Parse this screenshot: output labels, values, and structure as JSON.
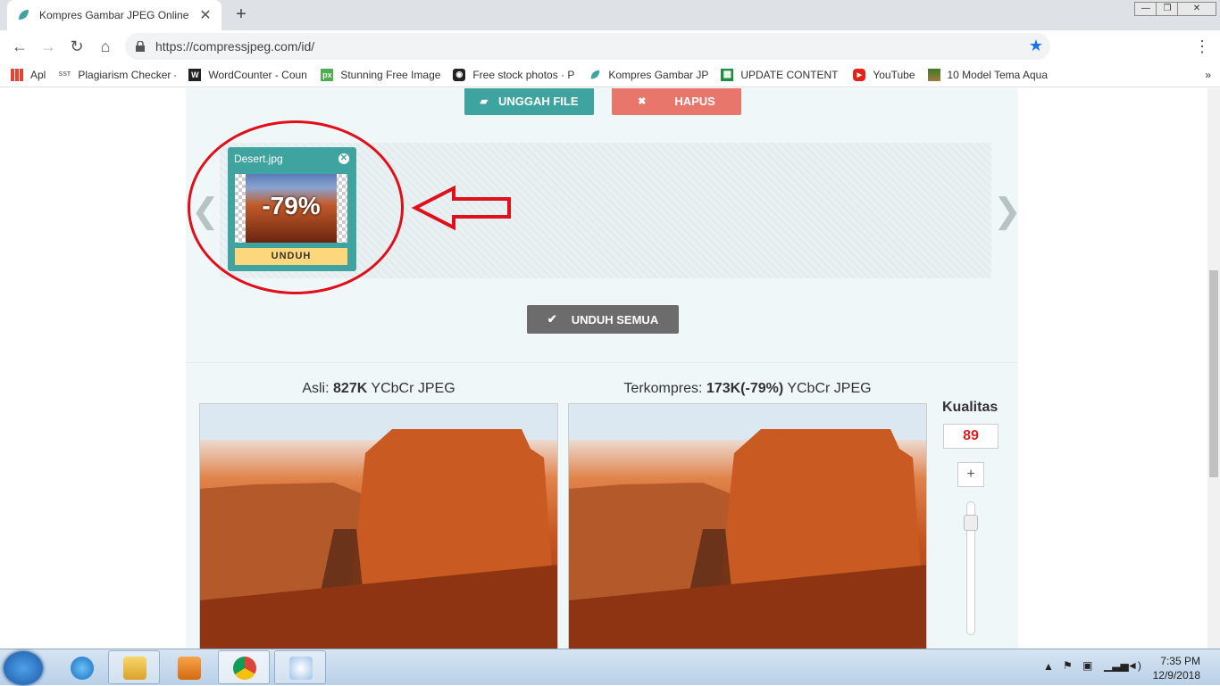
{
  "browser": {
    "tab_title": "Kompres Gambar JPEG Online",
    "new_tab": "+",
    "url": "https://compressjpeg.com/id/",
    "bookmarks": [
      {
        "label": "Apl",
        "icon": "apps-icon"
      },
      {
        "label": "Plagiarism Checker -",
        "icon": "sst-icon"
      },
      {
        "label": "WordCounter - Coun",
        "icon": "w-icon"
      },
      {
        "label": "Stunning Free Image",
        "icon": "px-icon"
      },
      {
        "label": "Free stock photos · P",
        "icon": "camera-icon"
      },
      {
        "label": "Kompres Gambar JPE",
        "icon": "leaf-icon"
      },
      {
        "label": "UPDATE CONTENT P",
        "icon": "sheets-icon"
      },
      {
        "label": "YouTube",
        "icon": "youtube-icon"
      },
      {
        "label": "10 Model Tema Aqua",
        "icon": "aquarium-icon"
      }
    ],
    "more_bookmarks": "»"
  },
  "page": {
    "upload_label": "UNGGAH FILE",
    "delete_label": "HAPUS",
    "file": {
      "name": "Desert.jpg",
      "reduction": "-79%",
      "download_label": "UNDUH"
    },
    "download_all_label": "UNDUH SEMUA",
    "original": {
      "prefix": "Asli:",
      "size": "827K",
      "suffix": "YCbCr JPEG"
    },
    "compressed": {
      "prefix": "Terkompres:",
      "size": "173K(-79%)",
      "suffix": "YCbCr JPEG"
    },
    "quality": {
      "label": "Kualitas",
      "value": "89",
      "plus": "+",
      "level": 0.89
    }
  },
  "taskbar": {
    "time": "7:35 PM",
    "date": "12/9/2018"
  },
  "colors": {
    "teal": "#3fa3a0",
    "salmon": "#e8766b",
    "yellow": "#fdd77b",
    "annotation_red": "#e0101a"
  }
}
